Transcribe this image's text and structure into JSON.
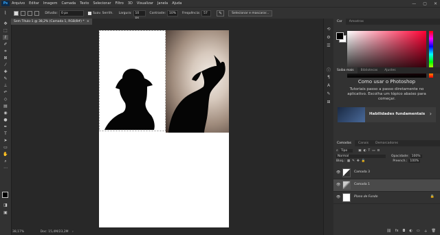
{
  "menu": {
    "logo": "Ps",
    "items": [
      "Arquivo",
      "Editar",
      "Imagem",
      "Camada",
      "Texto",
      "Selecionar",
      "Filtro",
      "3D",
      "Visualizar",
      "Janela",
      "Ajuda"
    ]
  },
  "window_controls": {
    "minimize": "—",
    "maximize": "▢",
    "close": "✕"
  },
  "options": {
    "difusao_label": "Difusão:",
    "difusao_value": "0 px",
    "suav_label": "Suav. Serrilh.",
    "largura_label": "Largura:",
    "largura_value": "10 px",
    "contraste_label": "Contraste:",
    "contraste_value": "10%",
    "frequencia_label": "Frequência:",
    "frequencia_value": "57",
    "select_mask_button": "Selecionar e mascarar..."
  },
  "document_tab": {
    "title": "Sem Título-1 @ 38,2% (Camada 1, RGB/8#) *",
    "close": "×"
  },
  "status": {
    "zoom": "38,17%",
    "doc": "Doc: 15,4M/23,2M"
  },
  "color_panel": {
    "tabs": [
      "Cor",
      "Amostras"
    ],
    "colors": {
      "hue_top": "#ff0000",
      "hue_mid": "#00ff00",
      "fg": "#000000",
      "bg": "#ffffff"
    }
  },
  "learn_panel": {
    "tabs": [
      "Saiba mais",
      "Bibliotecas",
      "Ajustes"
    ],
    "title": "Como usar o Photoshop",
    "description": "Tutoriais passo a passo diretamente no aplicativo. Escolha um tópico abaixo para começar.",
    "card_title": "Habilidades fundamentais",
    "card_arrow": "›"
  },
  "layers_panel": {
    "tabs": [
      "Camadas",
      "Canais",
      "Demarcadores"
    ],
    "search_label": "Tipo",
    "blend_mode": "Normal",
    "opacity_label": "Opacidade:",
    "opacity_value": "100%",
    "lock_label": "Bloq.:",
    "fill_label": "Preench.:",
    "fill_value": "100%",
    "layers": [
      {
        "name": "Camada 3"
      },
      {
        "name": "Camada 1"
      },
      {
        "name": "Plano de Fundo"
      }
    ]
  }
}
